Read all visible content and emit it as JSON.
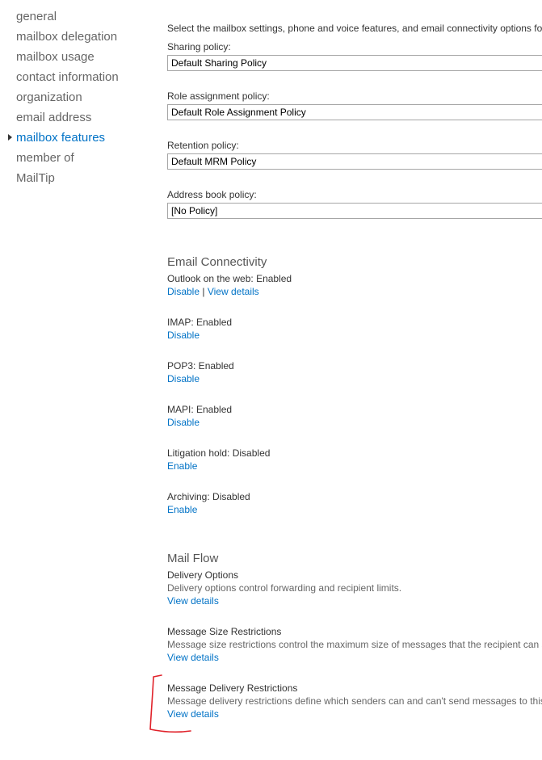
{
  "nav": {
    "items": [
      {
        "label": "general"
      },
      {
        "label": "mailbox delegation"
      },
      {
        "label": "mailbox usage"
      },
      {
        "label": "contact information"
      },
      {
        "label": "organization"
      },
      {
        "label": "email address"
      },
      {
        "label": "mailbox features"
      },
      {
        "label": "member of"
      },
      {
        "label": "MailTip"
      }
    ]
  },
  "intro": "Select the mailbox settings, phone and voice features, and email connectivity options fo",
  "policies": {
    "sharing": {
      "label": "Sharing policy:",
      "value": "Default Sharing Policy"
    },
    "role": {
      "label": "Role assignment policy:",
      "value": "Default Role Assignment Policy"
    },
    "retention": {
      "label": "Retention policy:",
      "value": "Default MRM Policy"
    },
    "address_book": {
      "label": "Address book policy:",
      "value": "[No Policy]"
    }
  },
  "email_connectivity": {
    "heading": "Email Connectivity",
    "owa": {
      "status": "Outlook on the web: Enabled",
      "disable": "Disable",
      "separator": "|",
      "details": "View details"
    },
    "imap": {
      "status": "IMAP: Enabled",
      "action": "Disable"
    },
    "pop3": {
      "status": "POP3: Enabled",
      "action": "Disable"
    },
    "mapi": {
      "status": "MAPI: Enabled",
      "action": "Disable"
    },
    "litigation": {
      "status": "Litigation hold: Disabled",
      "action": "Enable"
    },
    "archiving": {
      "status": "Archiving: Disabled",
      "action": "Enable"
    }
  },
  "mail_flow": {
    "heading": "Mail Flow",
    "delivery": {
      "title": "Delivery Options",
      "desc": "Delivery options control forwarding and recipient limits.",
      "link": "View details"
    },
    "size": {
      "title": "Message Size Restrictions",
      "desc": "Message size restrictions control the maximum size of messages that the recipient can s",
      "link": "View details"
    },
    "restrictions": {
      "title": "Message Delivery Restrictions",
      "desc": "Message delivery restrictions define which senders can and can't send messages to this",
      "link": "View details"
    }
  },
  "colors": {
    "link": "#0072c6",
    "annotation": "#e0222a",
    "nav_text": "#666666"
  }
}
